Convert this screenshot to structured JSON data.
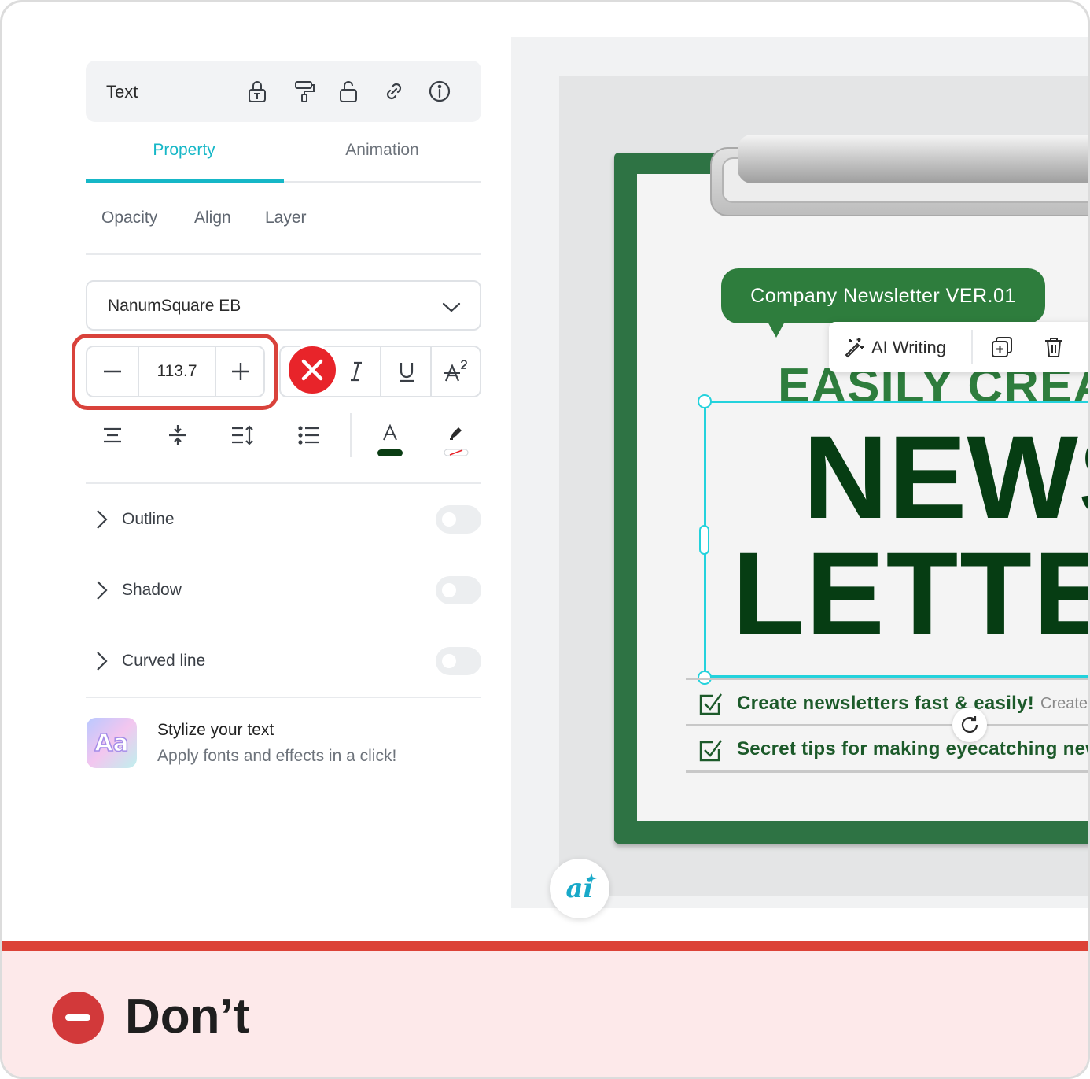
{
  "panel": {
    "title": "Text",
    "header_icons": [
      "text-lock-icon",
      "paint-roller-icon",
      "unlock-icon",
      "link-icon",
      "info-icon"
    ],
    "tabs": [
      {
        "label": "Property",
        "active": true
      },
      {
        "label": "Animation",
        "active": false
      }
    ],
    "subtabs": [
      "Opacity",
      "Align",
      "Layer"
    ],
    "font": "NanumSquare EB",
    "font_size": "113.7",
    "style_buttons": [
      "italic-icon",
      "underline-icon",
      "superscript-icon"
    ],
    "tool_icons": [
      "text-align-icon",
      "letter-spacing-icon",
      "line-height-icon",
      "bullet-list-icon",
      "text-color-icon",
      "highlight-color-icon"
    ],
    "text_color": "#0b3d14",
    "rows": [
      {
        "label": "Outline",
        "enabled": false
      },
      {
        "label": "Shadow",
        "enabled": false
      },
      {
        "label": "Curved line",
        "enabled": false
      }
    ],
    "promo": {
      "icon_text": "Aa",
      "title": "Stylize your text",
      "subtitle": "Apply fonts and effects in a click!"
    }
  },
  "canvas": {
    "bubble": "Company Newsletter VER.01",
    "context_toolbar": {
      "ai_writing": "AI Writing",
      "icons": [
        "magic-wand-icon",
        "duplicate-icon",
        "trash-icon"
      ]
    },
    "heading_small": "EASILY CREA",
    "heading_line1": "NEWS",
    "heading_line2": "LETTEF",
    "checklist": [
      "Create newsletters fast & easily!",
      "Secret tips for making eyecatching new"
    ],
    "checklist_aside": "Create",
    "ai_button": "ai",
    "colors": {
      "board": "#2e7344",
      "bubble": "#2e7d3d",
      "selection": "#23d2dc",
      "heading": "#063d13"
    }
  },
  "banner": {
    "label": "Don’t",
    "accent": "#dc4237",
    "background": "#fde9ea"
  }
}
